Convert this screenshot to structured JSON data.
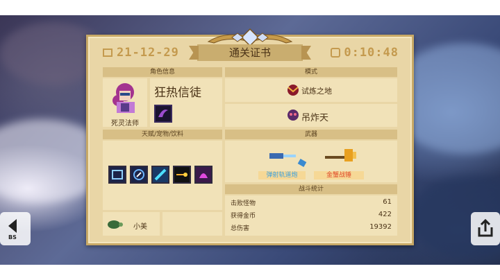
{
  "header": {
    "date": "21-12-29",
    "title": "通关证书",
    "time": "0:10:48"
  },
  "character": {
    "section_label": "角色信息",
    "name": "死灵法师",
    "title": "狂热信徒"
  },
  "mode": {
    "section_label": "模式",
    "items": [
      "试炼之地",
      "吊炸天"
    ]
  },
  "talents": {
    "section_label": "天赋/宠物/饮料",
    "pet_name": "小美"
  },
  "weapons": {
    "section_label": "武器",
    "items": [
      {
        "name": "弹射轨道炮",
        "color": "#3aa0e0"
      },
      {
        "name": "金蟹战锤",
        "color": "#e04a2a"
      }
    ]
  },
  "stats": {
    "section_label": "战斗统计",
    "rows": [
      {
        "label": "击败怪物",
        "value": "61"
      },
      {
        "label": "获得金币",
        "value": "422"
      },
      {
        "label": "总伤害",
        "value": "19392"
      }
    ]
  },
  "nav": {
    "back_label": "BS"
  },
  "colors": {
    "panel": "#e9d6a6",
    "header_strip": "#d8bf86",
    "cell": "#f1e2b8",
    "gold_text": "#c49a4e"
  }
}
